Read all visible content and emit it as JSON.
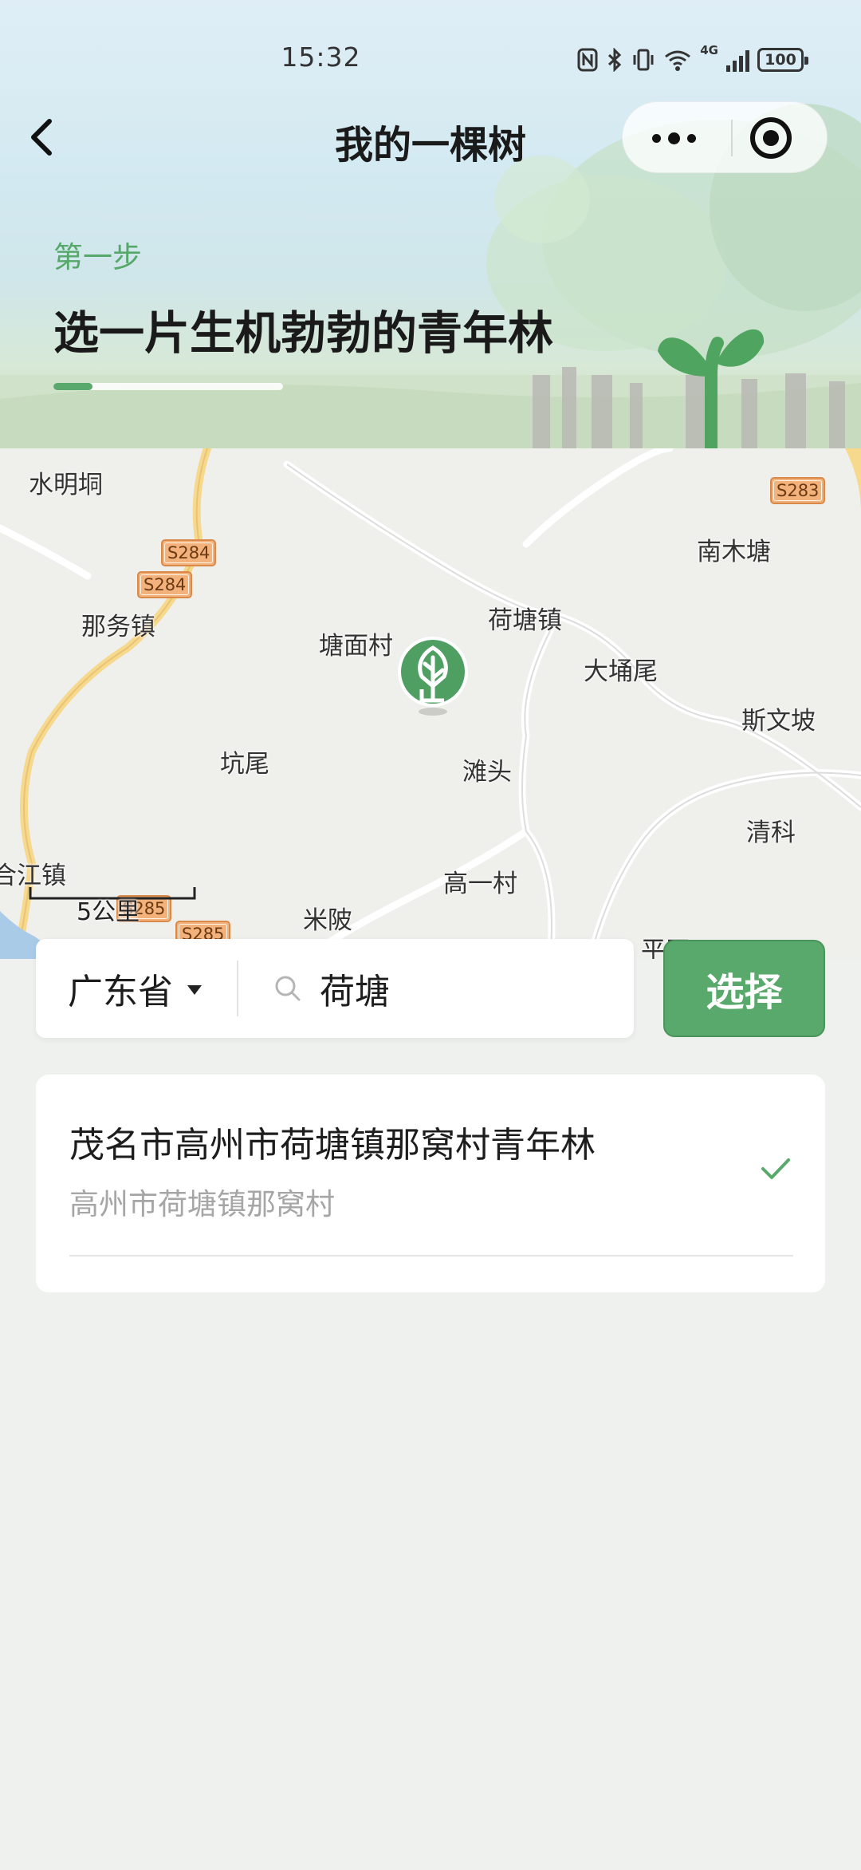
{
  "status_bar": {
    "time": "15:32",
    "network": "4G",
    "battery": "100",
    "icons": [
      "nfc-icon",
      "bluetooth-icon",
      "vibrate-icon",
      "wifi-icon",
      "signal-icon",
      "battery-icon"
    ]
  },
  "nav": {
    "title": "我的一棵树"
  },
  "step": {
    "label": "第一步",
    "title": "选一片生机勃勃的青年林",
    "progress_fraction": 0.17
  },
  "map": {
    "places": [
      "水明垌",
      "那务镇",
      "塘面村",
      "荷塘镇",
      "大埇尾",
      "南木塘",
      "斯文坡",
      "坑尾",
      "滩头",
      "清科",
      "合江镇",
      "高一村",
      "米陂",
      "平田"
    ],
    "road_shields": [
      "S283",
      "S284",
      "S284",
      "S285",
      "S285"
    ],
    "scale_label": "5公里"
  },
  "search": {
    "province": "广东省",
    "query": "荷塘",
    "button_label": "选择"
  },
  "results": [
    {
      "title": "茂名市高州市荷塘镇那窝村青年林",
      "subtitle": "高州市荷塘镇那窝村",
      "selected": true
    }
  ],
  "colors": {
    "accent": "#5aa96c",
    "marker": "#4f9f63",
    "shield": "#f3b27b",
    "background": "#eff1ef"
  }
}
